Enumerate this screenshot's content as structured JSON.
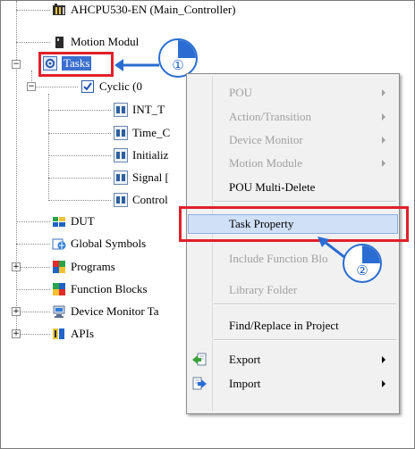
{
  "tree": {
    "items": [
      {
        "label": "AHCPU530-EN  (Main_Controller)",
        "icon": "plc-cpu-icon"
      },
      {
        "label": "Motion Modul",
        "icon": "motion-module-icon"
      },
      {
        "label": "Tasks",
        "icon": "tasks-gear-icon",
        "expander": "−"
      },
      {
        "label": "Cyclic (0",
        "icon": "checkbox-checked-icon",
        "expander": "−"
      },
      {
        "label": "INT_T",
        "icon": "task-block-icon"
      },
      {
        "label": "Time_C",
        "icon": "task-block-icon"
      },
      {
        "label": "Initializ",
        "icon": "task-block-icon"
      },
      {
        "label": "Signal [",
        "icon": "task-block-icon"
      },
      {
        "label": "Control",
        "icon": "task-block-icon"
      },
      {
        "label": "DUT",
        "icon": "dut-icon"
      },
      {
        "label": "Global Symbols",
        "icon": "global-symbols-icon"
      },
      {
        "label": "Programs",
        "icon": "programs-icon",
        "expander": "+"
      },
      {
        "label": "Function Blocks",
        "icon": "function-blocks-icon"
      },
      {
        "label": "Device Monitor Ta",
        "icon": "device-monitor-icon",
        "expander": "+"
      },
      {
        "label": "APIs",
        "icon": "apis-icon",
        "expander": "+"
      }
    ]
  },
  "context_menu": {
    "items": [
      {
        "label": "POU",
        "enabled": false,
        "submenu": true
      },
      {
        "label": "Action/Transition",
        "enabled": false,
        "submenu": true
      },
      {
        "label": "Device Monitor",
        "enabled": false,
        "submenu": true
      },
      {
        "label": "Motion Module",
        "enabled": false,
        "submenu": true
      },
      {
        "label": "POU Multi-Delete",
        "enabled": true,
        "submenu": false
      },
      {
        "label": "Task Property",
        "enabled": true,
        "submenu": false,
        "highlighted": true
      },
      {
        "label": "Include Function Blo",
        "enabled": false,
        "submenu": false
      },
      {
        "label": "Library Folder",
        "enabled": false,
        "submenu": false
      },
      {
        "label": "Find/Replace in Project",
        "enabled": true,
        "submenu": false
      },
      {
        "label": "Export",
        "enabled": true,
        "submenu": true,
        "icon": "export-icon"
      },
      {
        "label": "Import",
        "enabled": true,
        "submenu": true,
        "icon": "import-icon"
      }
    ]
  },
  "callouts": {
    "step1": "①",
    "step2": "②"
  },
  "colors": {
    "highlight_box": "#e1202a",
    "callout_blue": "#2a6cd1",
    "menu_highlight": "#cfe0f7"
  }
}
